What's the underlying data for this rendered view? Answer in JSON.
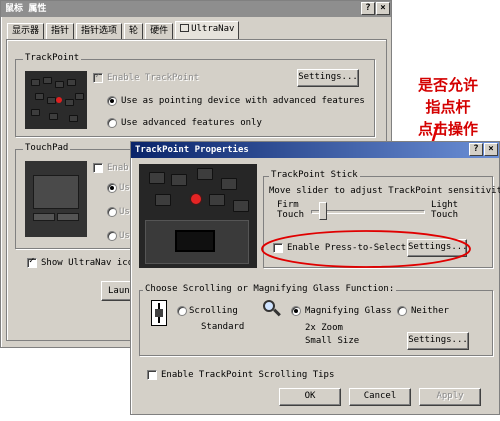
{
  "back_window": {
    "title": "鼠标 属性",
    "tabs": [
      "显示器",
      "指针",
      "指针选项",
      "轮",
      "硬件",
      "UltraNav"
    ],
    "trackpoint_group": "TrackPoint",
    "enable_trackpoint": "Enable TrackPoint",
    "settings_label": "Settings...",
    "use_pointing_label": "Use as pointing device with advanced features",
    "use_advanced_label": "Use advanced features only",
    "touchpad_group": "TouchPad",
    "enable_touchpad": "Enab",
    "touchpad_radios": [
      "Us",
      "Us",
      "Us"
    ],
    "show_ultranav_label": "Show UltraNav icon",
    "launch_label": "Laun"
  },
  "dialog": {
    "title": "TrackPoint Properties",
    "stick_group": "TrackPoint Stick",
    "slider_instruction": "Move slider to adjust TrackPoint sensitivity.",
    "firm_touch": "Firm\nTouch",
    "light_touch": "Light\nTouch",
    "slider_value_fraction": 0.08,
    "press_to_select": "Enable Press-to-Select",
    "press_settings": "Settings...",
    "scroll_group": "Choose Scrolling or Magnifying Glass Function:",
    "scrolling_label": "Scrolling",
    "scrolling_sub": "Standard",
    "magnifying_label": "Magnifying Glass",
    "magnifying_sub": "2x Zoom\nSmall Size",
    "neither_label": "Neither",
    "glass_settings": "Settings...",
    "scrolling_tips": "Enable TrackPoint Scrolling Tips",
    "ok": "OK",
    "cancel": "Cancel",
    "apply": "Apply"
  },
  "annotation": {
    "text": "是否允许\n指点杆\n点击操作",
    "color": "#d40000"
  }
}
